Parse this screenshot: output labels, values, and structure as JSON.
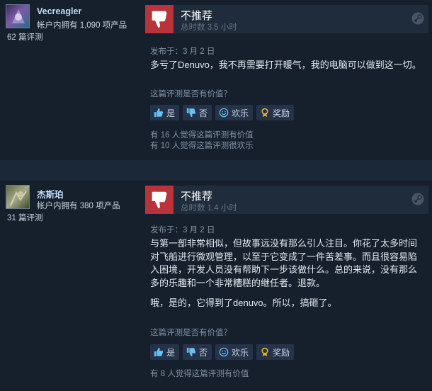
{
  "reviews": [
    {
      "author": {
        "name": "Vecreagler",
        "products": "帐户内拥有 1,090 项产品",
        "review_count": "62 篇评测"
      },
      "verdict": "不推荐",
      "hours": "总时数 3.5 小时",
      "posted": "发布于：3 月 2 日",
      "paragraphs": [
        "多亏了Denuvo，我不再需要打开暖气，我的电脑可以做到这一切。"
      ],
      "helpful_question": "这篇评测是否有价值？",
      "buttons": {
        "yes": "是",
        "no": "否",
        "funny": "欢乐",
        "award": "奖励"
      },
      "stats": [
        "有 16 人觉得这篇评测有价值",
        "有 10 人觉得这篇评测很欢乐"
      ]
    },
    {
      "author": {
        "name": "杰斯珀",
        "products": "帐户内拥有 380 项产品",
        "review_count": "31 篇评测"
      },
      "verdict": "不推荐",
      "hours": "总时数 1.4 小时",
      "posted": "发布于：3 月 2 日",
      "paragraphs": [
        "与第一部非常相似，但故事远没有那么引人注目。你花了太多时间对飞船进行微观管理，以至于它变成了一件苦差事。而且很容易陷入困境，开发人员没有帮助下一步该做什么。总的来说，没有那么多的乐趣和一个非常糟糕的继任者。退款。",
        "哦，是的，它得到了denuvo。所以，搞砸了。"
      ],
      "helpful_question": "这篇评测是否有价值？",
      "buttons": {
        "yes": "是",
        "no": "否",
        "funny": "欢乐",
        "award": "奖励"
      },
      "stats": [
        "有 8 人觉得这篇评测有价值"
      ]
    }
  ],
  "icons": {
    "thumbs_down": "thumbs-down-icon",
    "steam": "steam-icon",
    "thumb_up_small": "thumbs-up-icon",
    "thumb_down_small": "thumbs-down-icon",
    "funny": "smiley-icon",
    "award": "award-icon"
  },
  "colors": {
    "background": "#1b2838",
    "review_background": "#16202d",
    "thumb_box": "#b8343a",
    "author_name": "#c1dbf4",
    "award_icon": "#e8b923"
  }
}
